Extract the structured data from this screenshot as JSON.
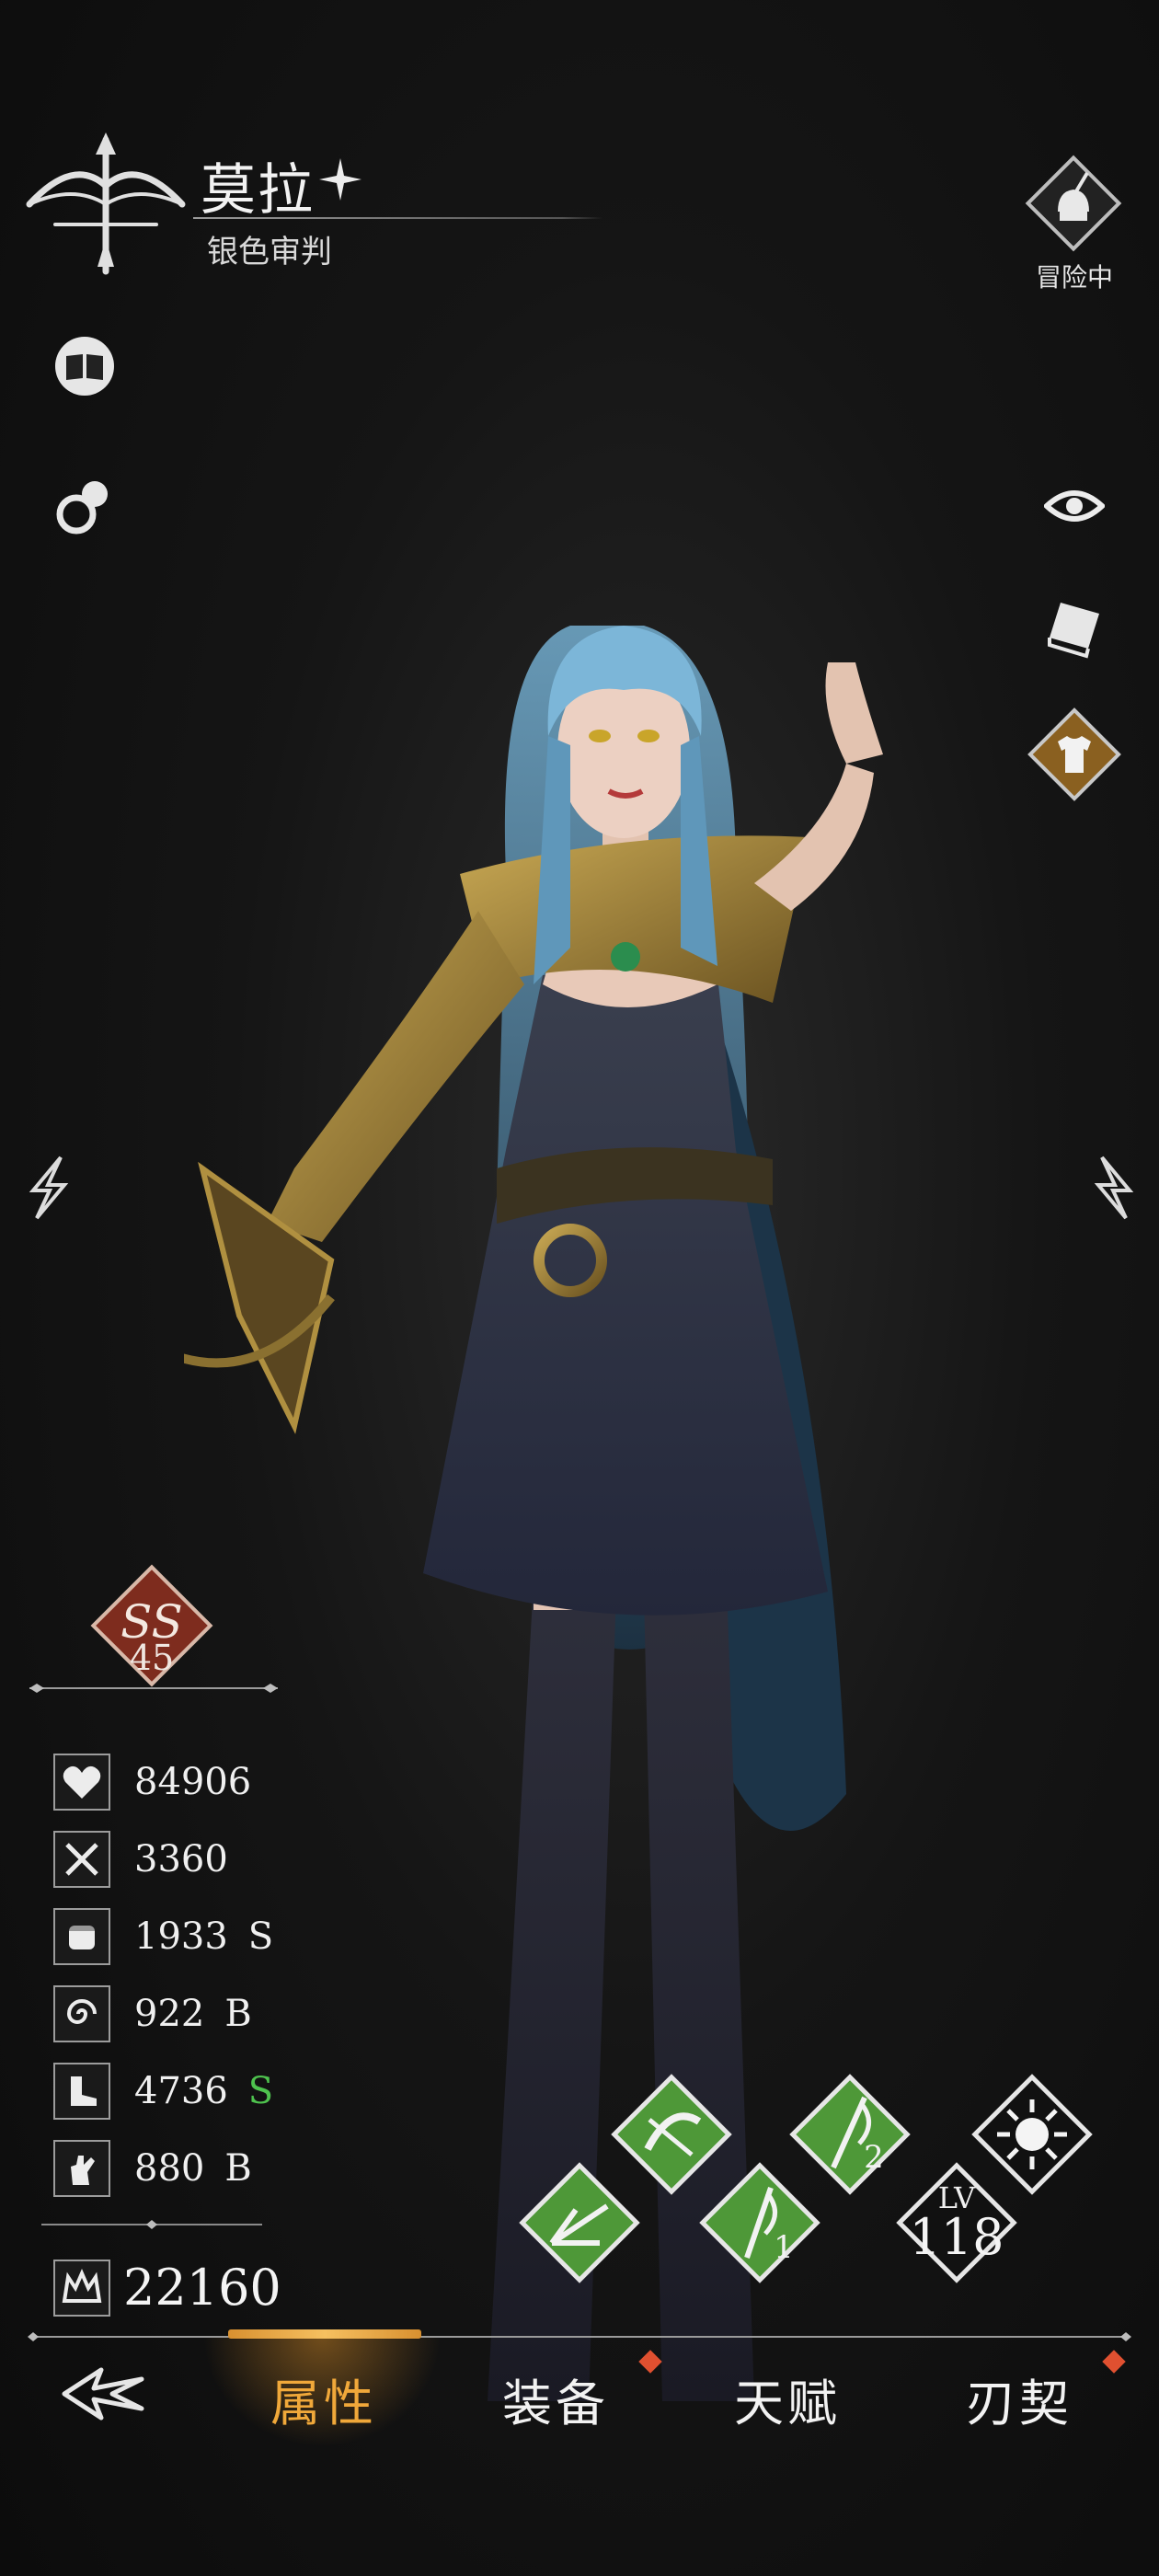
{
  "header": {
    "name": "莫拉",
    "title": "银色审判",
    "status_label": "冒险中"
  },
  "rank": {
    "grade": "SS",
    "level": "45"
  },
  "stats": [
    {
      "icon": "heart-icon",
      "value": "84906",
      "grade": ""
    },
    {
      "icon": "crossed-swords-icon",
      "value": "3360",
      "grade": ""
    },
    {
      "icon": "fist-icon",
      "value": "1933",
      "grade": "S"
    },
    {
      "icon": "swirl-icon",
      "value": "922",
      "grade": "B"
    },
    {
      "icon": "boot-icon",
      "value": "4736",
      "grade": "S"
    },
    {
      "icon": "hand-icon",
      "value": "880",
      "grade": "B"
    }
  ],
  "power": {
    "icon": "crown-icon",
    "value": "22160"
  },
  "skills": {
    "lv_label": "LV",
    "level": "118",
    "skill1_num": "1",
    "skill2_num": "2"
  },
  "nav": {
    "tabs": [
      "属性",
      "装备",
      "天赋",
      "刃契"
    ],
    "active": "属性"
  },
  "colors": {
    "accent": "#f0a83a",
    "skill_green": "#5aa840",
    "rank_red": "#8a3020",
    "grade_green": "#4ec24e",
    "notify_dot": "#e05030"
  }
}
